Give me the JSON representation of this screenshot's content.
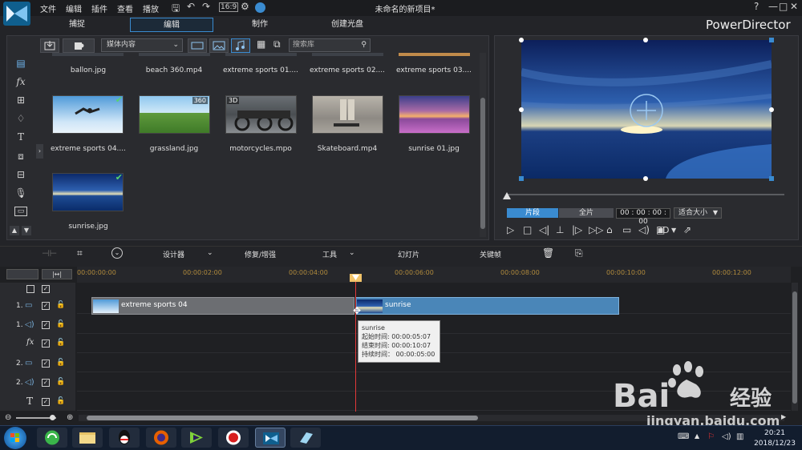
{
  "window": {
    "title": "未命名的新项目*",
    "menu": [
      "文件",
      "编辑",
      "插件",
      "查看",
      "播放"
    ],
    "brand": "PowerDirector",
    "help": "?",
    "minimize": "—",
    "maximize": "□",
    "close": "✕"
  },
  "modes": [
    {
      "label": "捕捉",
      "active": false
    },
    {
      "label": "编辑",
      "active": true
    },
    {
      "label": "制作",
      "active": false
    },
    {
      "label": "创建光盘",
      "active": false
    }
  ],
  "library": {
    "filter_label": "媒体内容",
    "search_placeholder": "搜索库",
    "top_row_labels": [
      "ballon.jpg",
      "beach 360.mp4",
      "extreme sports 01....",
      "extreme sports 02....",
      "extreme sports 03...."
    ],
    "items": [
      {
        "label": "extreme sports 04....",
        "badge": "",
        "used": true
      },
      {
        "label": "grassland.jpg",
        "badge": "360",
        "used": false
      },
      {
        "label": "motorcycles.mpo",
        "badge": "3D",
        "used": false
      },
      {
        "label": "Skateboard.mp4",
        "badge": "",
        "used": false
      },
      {
        "label": "sunrise 01.jpg",
        "badge": "",
        "used": false
      },
      {
        "label": "sunrise.jpg",
        "badge": "",
        "used": true
      }
    ]
  },
  "preview": {
    "tab_clip": "片段",
    "tab_movie": "全片",
    "timecode": "00 : 00 : 00 : 00",
    "zoom": "适合大小",
    "mode_3d": "3D"
  },
  "edit_toolbar": {
    "designer": "设计器",
    "fix_enhance": "修复/增强",
    "tools": "工具",
    "slideshow": "幻灯片",
    "keyframe": "关键帧"
  },
  "timeline": {
    "ticks": [
      "00:00:00:00",
      "00:00:02:00",
      "00:00:04:00",
      "00:00:06:00",
      "00:00:08:00",
      "00:00:10:00",
      "00:00:12:00"
    ],
    "tracks": [
      {
        "num": "1.",
        "icon": "video-track-icon"
      },
      {
        "num": "1.",
        "icon": "audio-track-icon"
      },
      {
        "num": "",
        "icon": "fx-track-icon"
      },
      {
        "num": "2.",
        "icon": "video-track-icon"
      },
      {
        "num": "2.",
        "icon": "audio-track-icon"
      },
      {
        "num": "",
        "icon": "title-track-icon"
      }
    ],
    "clips": [
      {
        "label": "extreme sports 04"
      },
      {
        "label": "sunrise"
      }
    ],
    "tooltip": {
      "name": "sunrise",
      "start": "起始时间: 00:00:05:07",
      "end": "结束时间: 00:00:10:07",
      "duration": "持续时间： 00:00:05:00"
    }
  },
  "taskbar": {
    "time": "20:21",
    "date": "2018/12/23"
  },
  "watermark": {
    "brand": "Bai",
    "brand2": "经验",
    "url": "jingyan.baidu.com"
  },
  "colors": {
    "accent": "#3a8bd0",
    "clip_video": "#6c6e72",
    "clip_image": "#4a86b8",
    "playhead": "#e23838"
  }
}
